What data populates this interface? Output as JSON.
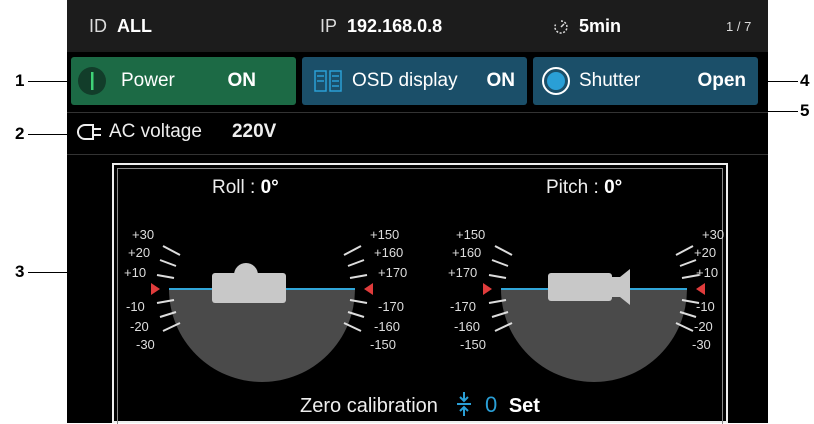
{
  "status_bar": {
    "id_label": "ID",
    "id_value": "ALL",
    "ip_label": "IP",
    "ip_value": "192.168.0.8",
    "timer_value": "5min",
    "page_indicator": "1 / 7"
  },
  "buttons": {
    "power": {
      "label": "Power",
      "value": "ON"
    },
    "osd": {
      "label": "OSD display",
      "value": "ON"
    },
    "shutter": {
      "label": "Shutter",
      "value": "Open"
    }
  },
  "ac_voltage": {
    "label": "AC voltage",
    "value": "220V"
  },
  "roll": {
    "label": "Roll : ",
    "value": "0°",
    "left_ticks": [
      "+30",
      "+20",
      "+10",
      "-10",
      "-20",
      "-30"
    ],
    "right_ticks": [
      "+150",
      "+160",
      "+170",
      "-170",
      "-160",
      "-150"
    ]
  },
  "pitch": {
    "label": "Pitch : ",
    "value": "0°",
    "left_ticks": [
      "+150",
      "+160",
      "+170",
      "-170",
      "-160",
      "-150"
    ],
    "right_ticks": [
      "+30",
      "+20",
      "+10",
      "-10",
      "-20",
      "-30"
    ]
  },
  "zero_calibration": {
    "label": "Zero calibration",
    "value": "0",
    "action": "Set"
  },
  "callouts": [
    "1",
    "2",
    "3",
    "4",
    "5"
  ],
  "colors": {
    "accent": "#2a9fd6",
    "green": "#1c6a45",
    "blue": "#1b4f69",
    "marker": "#e03c3c",
    "horizon": "#31a6d9"
  }
}
